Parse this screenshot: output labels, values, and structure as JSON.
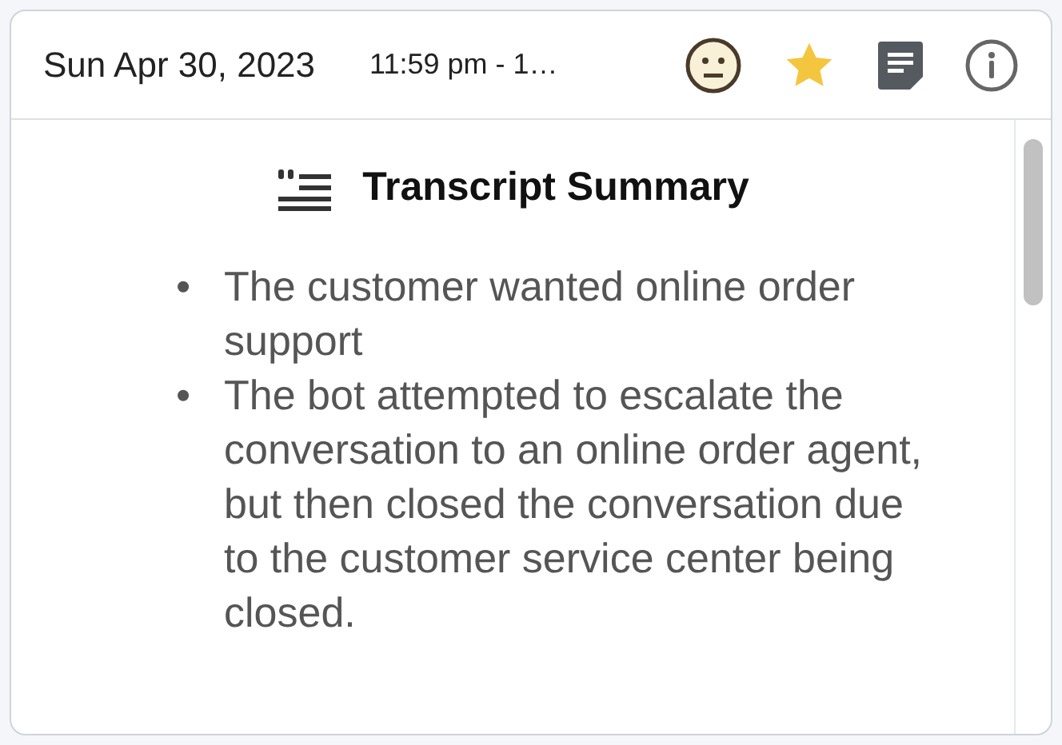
{
  "header": {
    "date": "Sun Apr 30, 2023",
    "time": "11:59 pm - 1…"
  },
  "summary": {
    "title": "Transcript Summary",
    "bullets": [
      {
        "marker": "•",
        "text": "The customer wanted online order support"
      },
      {
        "marker": "•",
        "text": "The bot attempted to escalate the conversation to an online order agent, but then closed the conversation due to the customer service center being closed."
      }
    ]
  }
}
